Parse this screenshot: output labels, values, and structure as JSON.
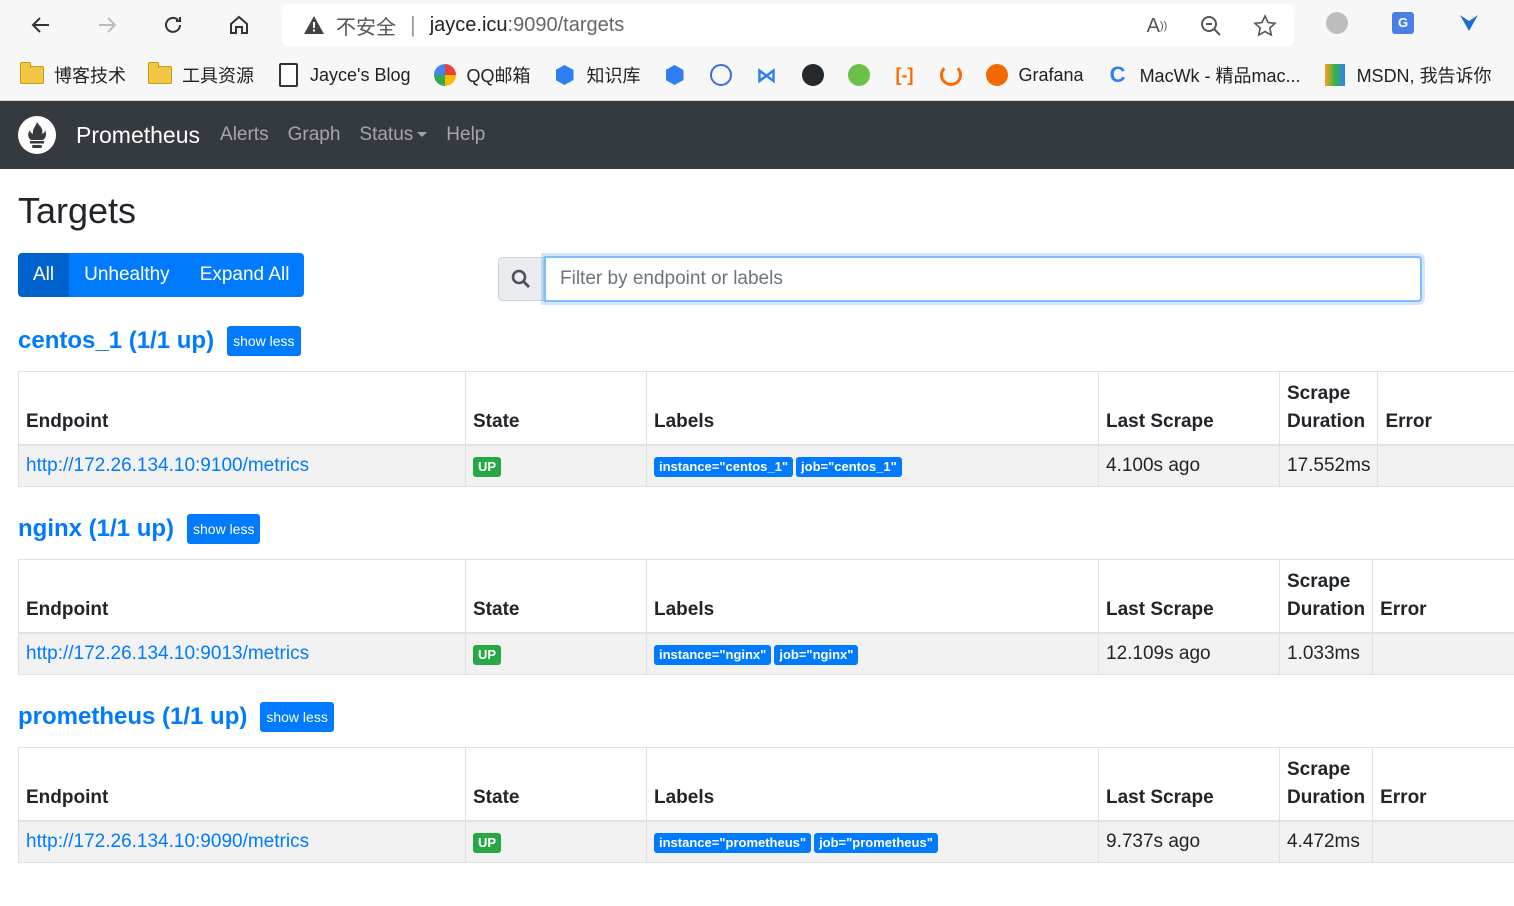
{
  "browser": {
    "insecure_label": "不安全",
    "url_host": "jayce.icu",
    "url_rest": ":9090/targets",
    "bookmarks": [
      {
        "label": "博客技术",
        "icon": "folder-icon"
      },
      {
        "label": "工具资源",
        "icon": "folder-icon"
      },
      {
        "label": "Jayce's Blog",
        "icon": "page-icon"
      },
      {
        "label": "QQ邮箱",
        "icon": "qq-mail-icon"
      },
      {
        "label": "知识库",
        "icon": "knowledge-icon"
      },
      {
        "label": "Grafana",
        "icon": "grafana-icon"
      },
      {
        "label": "MacWk - 精品mac...",
        "icon": "macwk-icon"
      },
      {
        "label": "MSDN, 我告诉你",
        "icon": "msdn-icon"
      }
    ]
  },
  "nav": {
    "brand": "Prometheus",
    "links": {
      "alerts": "Alerts",
      "graph": "Graph",
      "status": "Status",
      "help": "Help"
    }
  },
  "page": {
    "title": "Targets",
    "filters": {
      "all": "All",
      "unhealthy": "Unhealthy",
      "expand_all": "Expand All"
    },
    "search_placeholder": "Filter by endpoint or labels"
  },
  "columns": {
    "endpoint": "Endpoint",
    "state": "State",
    "labels": "Labels",
    "last_scrape": "Last Scrape",
    "scrape_duration_1": "Scrape",
    "scrape_duration_2": "Duration",
    "error": "Error"
  },
  "pools": [
    {
      "title": "centos_1 (1/1 up)",
      "toggle": "show less",
      "endpoint": "http://172.26.134.10:9100/metrics",
      "state": "UP",
      "labels": [
        "instance=\"centos_1\"",
        "job=\"centos_1\""
      ],
      "last_scrape": "4.100s ago",
      "duration": "17.552ms",
      "error": ""
    },
    {
      "title": "nginx (1/1 up)",
      "toggle": "show less",
      "endpoint": "http://172.26.134.10:9013/metrics",
      "state": "UP",
      "labels": [
        "instance=\"nginx\"",
        "job=\"nginx\""
      ],
      "last_scrape": "12.109s ago",
      "duration": "1.033ms",
      "error": ""
    },
    {
      "title": "prometheus (1/1 up)",
      "toggle": "show less",
      "endpoint": "http://172.26.134.10:9090/metrics",
      "state": "UP",
      "labels": [
        "instance=\"prometheus\"",
        "job=\"prometheus\""
      ],
      "last_scrape": "9.737s ago",
      "duration": "4.472ms",
      "error": ""
    }
  ],
  "colors": {
    "accent": "#007bff",
    "up": "#28a745",
    "navbar": "#343a40"
  }
}
